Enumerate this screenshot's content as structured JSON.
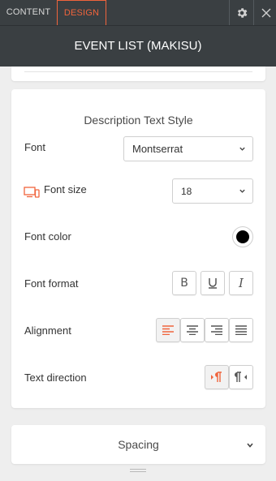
{
  "tabs": {
    "content": "CONTENT",
    "design": "DESIGN"
  },
  "header": {
    "title": "EVENT LIST (MAKISU)"
  },
  "colors": {
    "accent": "#f0643c",
    "topbar": "#3a3f42",
    "font_color_value": "#000000"
  },
  "section": {
    "title": "Description Text Style"
  },
  "font": {
    "label": "Font",
    "value": "Montserrat"
  },
  "font_size": {
    "label": "Font size",
    "value": "18",
    "icon": "devices-icon"
  },
  "font_color": {
    "label": "Font color"
  },
  "font_format": {
    "label": "Font format",
    "bold": "B",
    "italic": "I"
  },
  "alignment": {
    "label": "Alignment",
    "selected": "left"
  },
  "text_direction": {
    "label": "Text direction",
    "selected": "ltr"
  },
  "spacing": {
    "label": "Spacing"
  }
}
